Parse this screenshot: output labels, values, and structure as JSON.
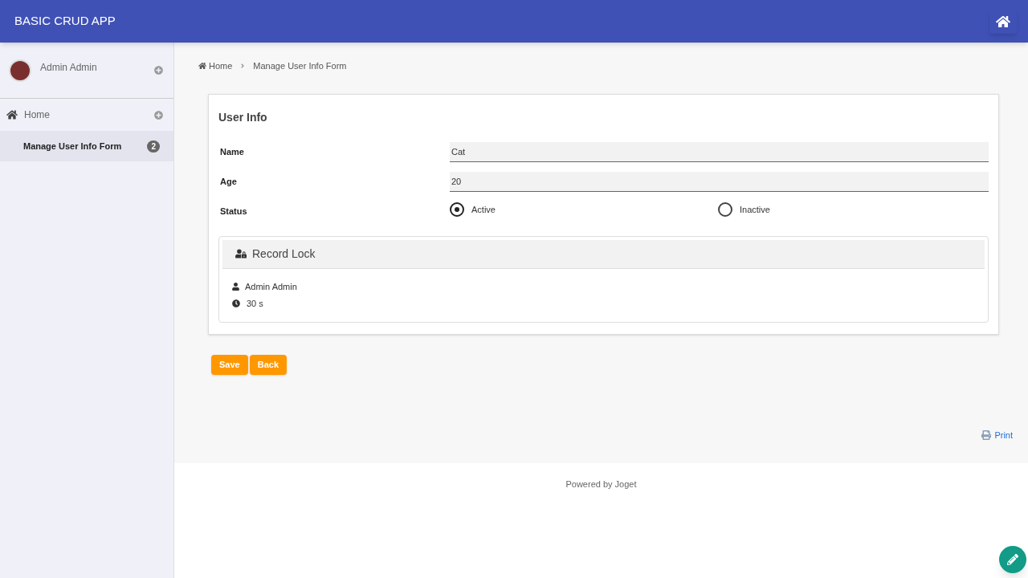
{
  "header": {
    "title": "BASIC CRUD APP"
  },
  "sidebar": {
    "user": "Admin Admin",
    "items": [
      {
        "label": "Home",
        "selected": false,
        "children": [
          {
            "label": "Manage User Info Form",
            "badge": "2",
            "selected": true
          }
        ]
      }
    ]
  },
  "breadcrumb": [
    "Home",
    "Manage User Info Form"
  ],
  "form": {
    "title": "User Info",
    "fields": [
      {
        "kind": "text",
        "label": "Name",
        "value": "Cat"
      },
      {
        "kind": "text",
        "label": "Age",
        "value": "20"
      },
      {
        "kind": "radio",
        "label": "Status",
        "options": [
          {
            "label": "Active",
            "selected": true
          },
          {
            "label": "Inactive",
            "selected": false
          }
        ]
      }
    ],
    "record_lock": {
      "title": "Record Lock",
      "user": "Admin Admin",
      "time": "30 s"
    }
  },
  "buttons": [
    "Save",
    "Back"
  ],
  "print": "Print",
  "footer": "Powered by Joget"
}
